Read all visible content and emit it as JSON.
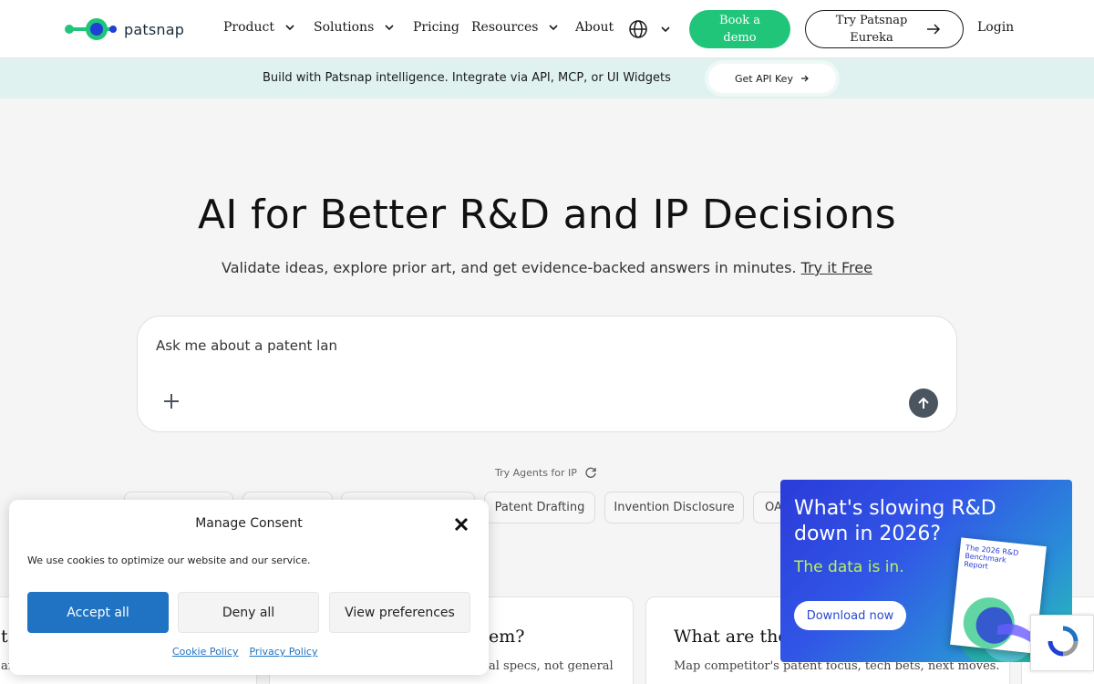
{
  "header": {
    "logo_text": "patsnap",
    "nav": [
      {
        "label": "Product",
        "has_dropdown": true
      },
      {
        "label": "Solutions",
        "has_dropdown": true
      },
      {
        "label": "Pricing",
        "has_dropdown": false
      },
      {
        "label": "Resources",
        "has_dropdown": true
      },
      {
        "label": "About",
        "has_dropdown": false
      }
    ],
    "language_icon": "globe-icon",
    "book_demo_label": "Book a demo",
    "try_label": "Try Patsnap Eureka",
    "login_label": "Login"
  },
  "banner": {
    "text": "Build with Patsnap intelligence. Integrate via API, MCP, or UI Widgets",
    "api_button_label": "Get API Key"
  },
  "hero": {
    "title": "AI for Better R&D and IP Decisions",
    "subtitle": "Validate ideas, explore prior art, and get evidence-backed answers in minutes.",
    "try_free_label": "Try it Free",
    "search_value": "Ask me about a patent lan",
    "search_placeholder": "Ask me about a patent lan"
  },
  "agents": {
    "label": "Try Agents for IP",
    "chips": [
      "",
      "",
      "",
      "Patent Drafting",
      "Invention Disclosure",
      "OA"
    ]
  },
  "cards": [
    {
      "title": "t",
      "desc": "an"
    },
    {
      "title": "em?",
      "desc": "al specs, not general"
    },
    {
      "title": "What are they",
      "desc": "Map competitor's patent focus, tech bets, next moves."
    }
  ],
  "consent": {
    "title": "Manage Consent",
    "text": "We use cookies to optimize our website and our service.",
    "accept_label": "Accept all",
    "deny_label": "Deny all",
    "view_label": "View preferences",
    "cookie_policy_label": "Cookie Policy",
    "privacy_policy_label": "Privacy Policy"
  },
  "promo": {
    "title": "What's slowing R&D down in 2026?",
    "subtitle": "The data is in.",
    "button_label": "Download now",
    "report_title": "The 2026 R&D Benchmark Report"
  },
  "colors": {
    "brand_green": "#20c57a",
    "banner_bg": "#dff2ef",
    "accept_blue": "#1f73c2",
    "promo_accent": "#b8f25a"
  }
}
